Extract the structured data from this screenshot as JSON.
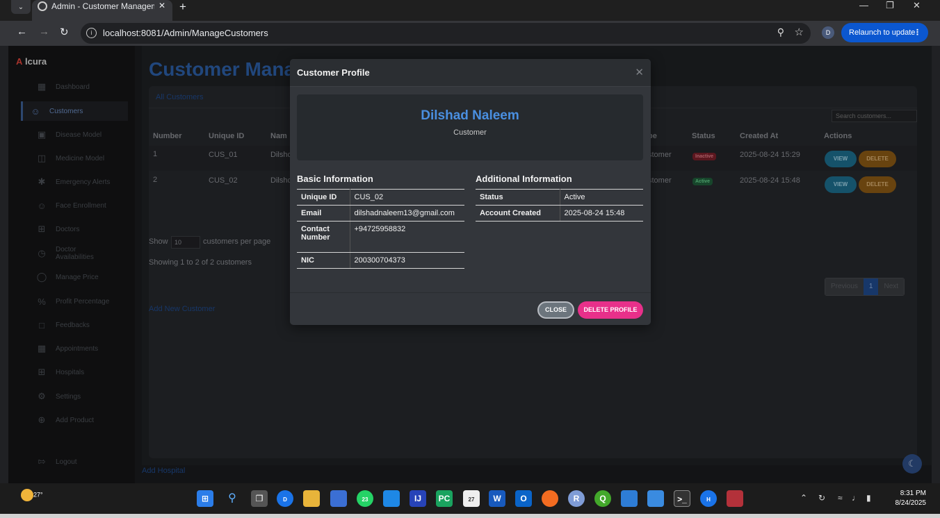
{
  "browser": {
    "tab_title": "Admin - Customer Management",
    "url": "localhost:8081/Admin/ManageCustomers",
    "profile_initial": "D",
    "relaunch_label": "Relaunch to update"
  },
  "sidebar": {
    "logo_prefix": "A",
    "logo_rest": "lcura",
    "items": [
      {
        "label": "Dashboard"
      },
      {
        "label": "Customers"
      },
      {
        "label": "Disease Model"
      },
      {
        "label": "Medicine Model"
      },
      {
        "label": "Emergency Alerts"
      },
      {
        "label": "Face Enrollment"
      },
      {
        "label": "Doctors"
      },
      {
        "label": "Doctor Availabilities"
      },
      {
        "label": "Manage Price"
      },
      {
        "label": "Profit Percentage"
      },
      {
        "label": "Feedbacks"
      },
      {
        "label": "Appointments"
      },
      {
        "label": "Hospitals"
      },
      {
        "label": "Settings"
      },
      {
        "label": "Add Product"
      },
      {
        "label": "Logout"
      }
    ]
  },
  "main": {
    "page_title": "Customer Management",
    "card_header": "All Customers",
    "search_placeholder": "Search customers...",
    "columns": [
      "Number",
      "Unique ID",
      "Name",
      "Type",
      "Status",
      "Created At",
      "Actions"
    ],
    "visible_columns": {
      "number": "Number",
      "unique_id": "Unique ID",
      "name": "Nam",
      "type": "pe",
      "status": "Status",
      "created_at": "Created At",
      "actions": "Actions"
    },
    "rows": [
      {
        "number": "1",
        "unique_id": "CUS_01",
        "name": "Dilshc",
        "type": "stomer",
        "status": "Inactive",
        "created_at": "2025-08-24 15:29"
      },
      {
        "number": "2",
        "unique_id": "CUS_02",
        "name": "Dilshc",
        "type": "stomer",
        "status": "Active",
        "created_at": "2025-08-24 15:48"
      }
    ],
    "view_label": "VIEW",
    "delete_label": "DELETE",
    "show_label": "Show",
    "show_value": "10",
    "per_page_label": "customers per page",
    "showing_text": "Showing 1 to 2 of 2 customers",
    "add_new_label": "Add New Customer",
    "pager": {
      "prev": "Previous",
      "current": "1",
      "next": "Next"
    },
    "add_hospital_label": "Add Hospital"
  },
  "modal": {
    "title": "Customer Profile",
    "name": "Dilshad Naleem",
    "role": "Customer",
    "basic_title": "Basic Information",
    "basic": [
      {
        "key": "Unique ID",
        "value": "CUS_02"
      },
      {
        "key": "Email",
        "value": "dilshadnaleem13@gmail.com"
      },
      {
        "key": "Contact Number",
        "value": "+94725958832"
      },
      {
        "key": "NIC",
        "value": "200300704373"
      }
    ],
    "additional_title": "Additional Information",
    "additional": [
      {
        "key": "Status",
        "value": "Active"
      },
      {
        "key": "Account Created",
        "value": "2025-08-24 15:48"
      }
    ],
    "close_label": "CLOSE",
    "delete_label": "DELETE PROFILE"
  },
  "taskbar": {
    "temperature": "27°",
    "time": "8:31 PM",
    "date": "8/24/2025",
    "badges": {
      "chrome": "D",
      "whatsapp": "23",
      "notes": "27",
      "chrome2": "H"
    }
  },
  "colors": {
    "accent": "#2d5fa7",
    "profile_name": "#4a8fe0",
    "delete_profile": "#e8308a",
    "view_button": "#1d6e8e",
    "delete_button": "#8b5a14",
    "relaunch": "#0b57d0"
  }
}
